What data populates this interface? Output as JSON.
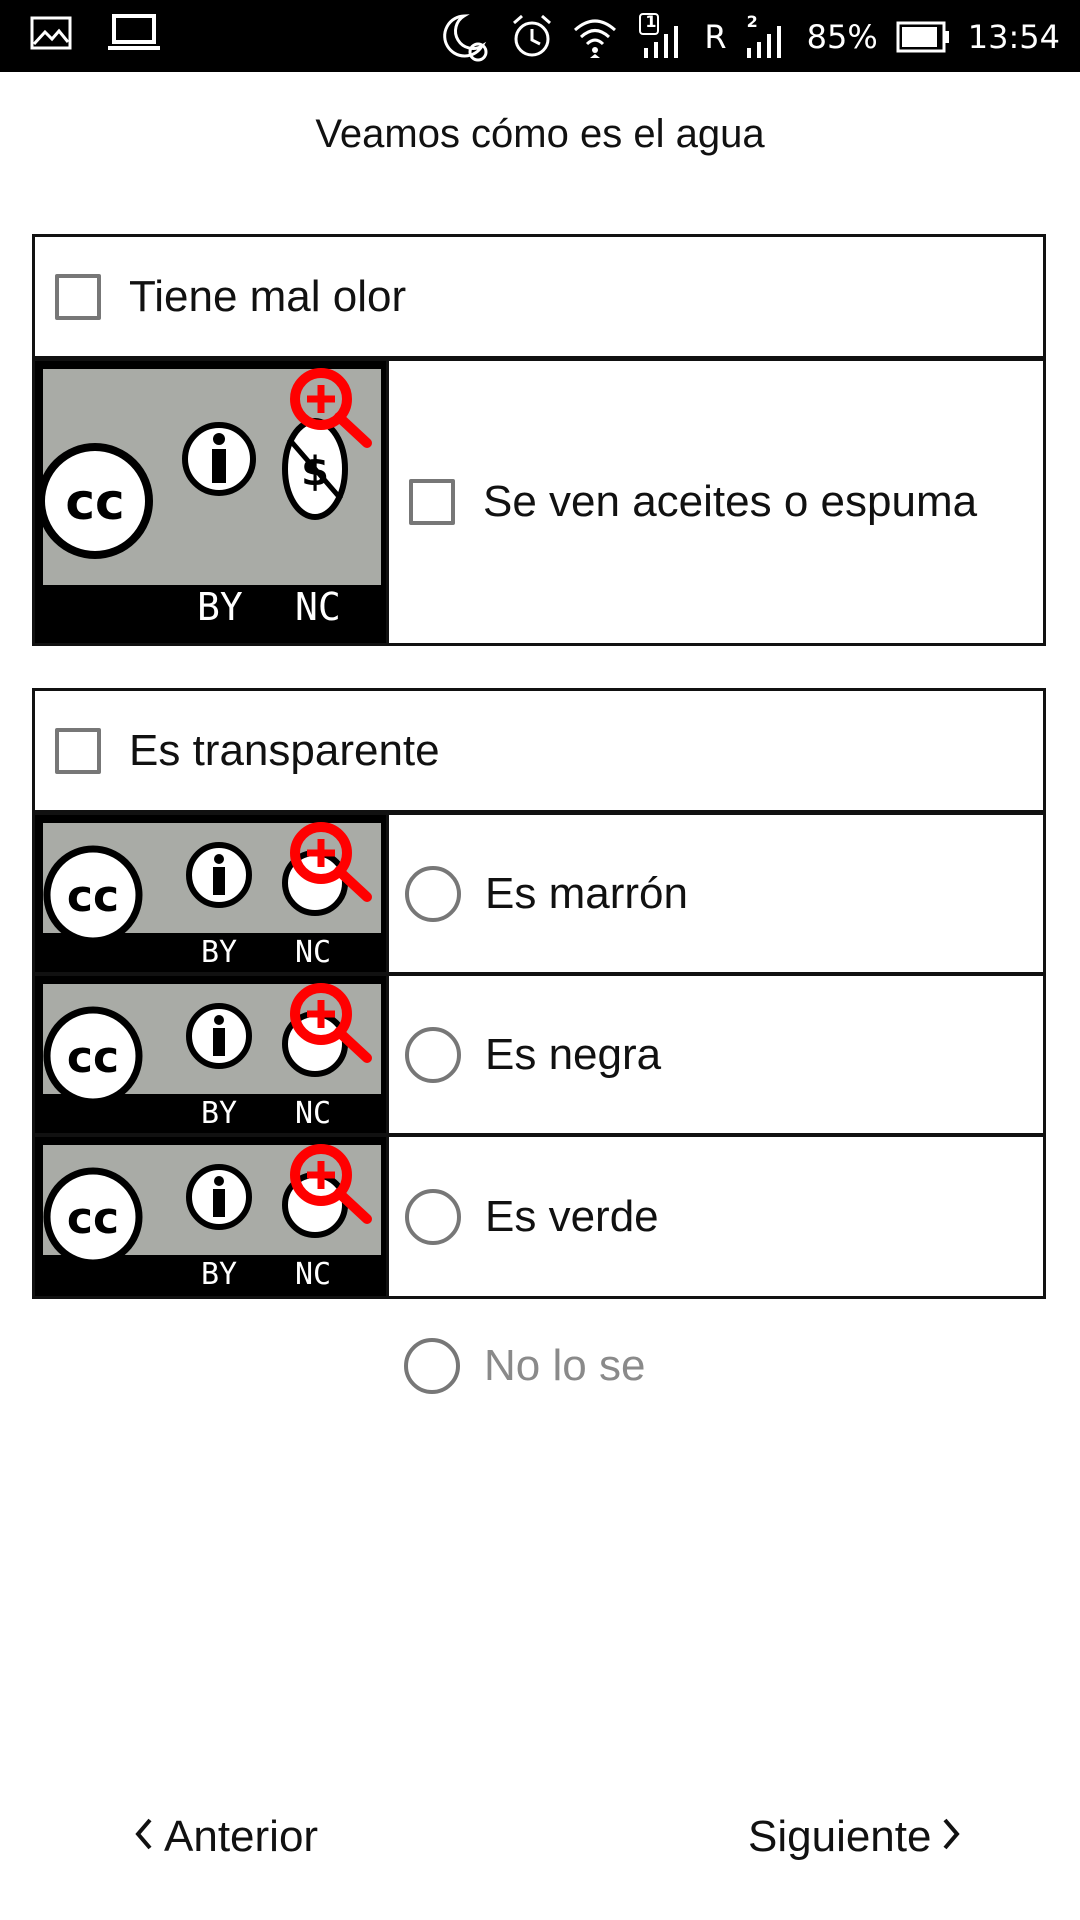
{
  "status_bar": {
    "icons_left": [
      "gallery-icon",
      "laptop-icon"
    ],
    "icons_right": [
      "do-not-disturb-icon",
      "alarm-icon",
      "wifi-icon",
      "sim1-signal-icon",
      "sim2-signal-icon",
      "battery-icon"
    ],
    "sim1_badge": "1",
    "roaming": "R",
    "sim2_badge": "2",
    "battery": "85%",
    "time": "13:54"
  },
  "page": {
    "title": "Veamos cómo es el agua"
  },
  "group1": {
    "header": {
      "label": "Tiene mal olor",
      "checked": false
    },
    "options": [
      {
        "label": "Se ven aceites o espuma",
        "type": "checkbox",
        "checked": false,
        "image": {
          "badge": "cc-by-nc",
          "by": "BY",
          "nc": "NC"
        }
      }
    ]
  },
  "group2": {
    "header": {
      "label": "Es transparente",
      "checked": false
    },
    "options": [
      {
        "label": "Es marrón",
        "type": "radio",
        "selected": false,
        "image": {
          "badge": "cc-by-nc",
          "by": "BY",
          "nc": "NC"
        }
      },
      {
        "label": "Es negra",
        "type": "radio",
        "selected": false,
        "image": {
          "badge": "cc-by-nc",
          "by": "BY",
          "nc": "NC"
        }
      },
      {
        "label": "Es verde",
        "type": "radio",
        "selected": false,
        "image": {
          "badge": "cc-by-nc",
          "by": "BY",
          "nc": "NC"
        }
      }
    ]
  },
  "no_lo_se": {
    "label": "No lo se",
    "selected": false
  },
  "navigation": {
    "prev_label": "Anterior",
    "next_label": "Siguiente"
  },
  "colors": {
    "zoom_icon": "#ff0000",
    "badge_gray": "#a9aba6",
    "border": "#111111",
    "control_gray": "#777777",
    "disabled_text": "#8a8a8a"
  }
}
